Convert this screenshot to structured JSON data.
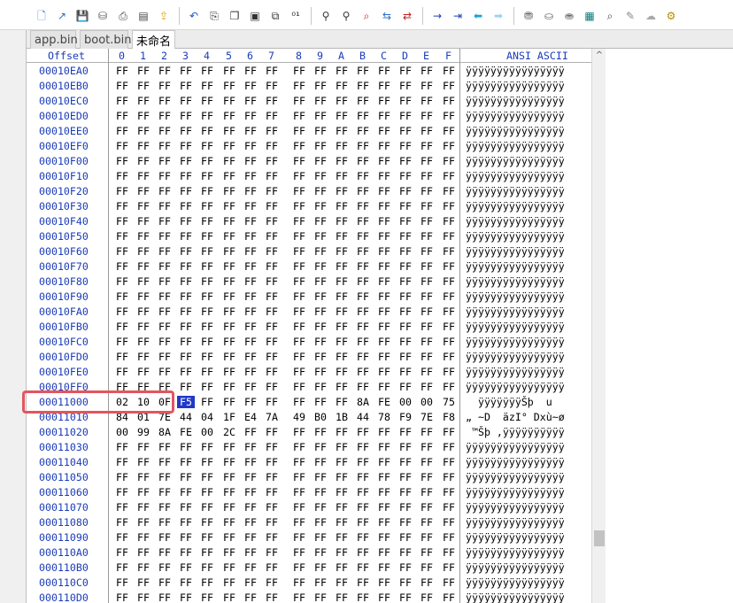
{
  "toolbar": {
    "buttons": [
      {
        "name": "new-file-icon",
        "glyph": "🗋",
        "color": "#3a6fd0"
      },
      {
        "name": "open-file-icon",
        "glyph": "↗",
        "color": "#2a70d0"
      },
      {
        "name": "save-icon",
        "glyph": "💾",
        "color": "#333"
      },
      {
        "name": "save-all-icon",
        "glyph": "⛁",
        "color": "#555"
      },
      {
        "name": "print-icon",
        "glyph": "⎙",
        "color": "#444"
      },
      {
        "name": "properties-icon",
        "glyph": "▤",
        "color": "#444"
      },
      {
        "name": "export-icon",
        "glyph": "⇪",
        "color": "#e0a000"
      },
      {
        "sep": true
      },
      {
        "name": "undo-icon",
        "glyph": "↶",
        "color": "#1a56c8"
      },
      {
        "name": "copy-icon",
        "glyph": "⎘",
        "color": "#333"
      },
      {
        "name": "copy-block-icon",
        "glyph": "❐",
        "color": "#333"
      },
      {
        "name": "paste-icon",
        "glyph": "▣",
        "color": "#333"
      },
      {
        "name": "paste-write-icon",
        "glyph": "⧉",
        "color": "#333"
      },
      {
        "name": "binary-icon",
        "glyph": "⁰¹",
        "color": "#333"
      },
      {
        "sep": true
      },
      {
        "name": "find-icon",
        "glyph": "⚲",
        "color": "#333"
      },
      {
        "name": "find-next-icon",
        "glyph": "⚲",
        "color": "#333"
      },
      {
        "name": "find-hex-icon",
        "glyph": "⌕",
        "color": "#c02020"
      },
      {
        "name": "replace-icon",
        "glyph": "⇆",
        "color": "#2a70d0"
      },
      {
        "name": "replace-hex-icon",
        "glyph": "⇄",
        "color": "#c02020"
      },
      {
        "sep": true
      },
      {
        "name": "goto-offset-icon",
        "glyph": "→",
        "color": "#1a3bb8"
      },
      {
        "name": "goto-sector-icon",
        "glyph": "⇥",
        "color": "#1a3bb8"
      },
      {
        "name": "back-icon",
        "glyph": "⬅",
        "color": "#1aa0d8"
      },
      {
        "name": "forward-icon",
        "glyph": "➡",
        "color": "#9ed2ec"
      },
      {
        "sep": true
      },
      {
        "name": "disk-icon",
        "glyph": "⛃",
        "color": "#666"
      },
      {
        "name": "disk-open-icon",
        "glyph": "⛀",
        "color": "#666"
      },
      {
        "name": "ram-icon",
        "glyph": "⛂",
        "color": "#666"
      },
      {
        "name": "calculator-icon",
        "glyph": "▦",
        "color": "#0a7a7a"
      },
      {
        "name": "zoom-icon",
        "glyph": "⌕",
        "color": "#444"
      },
      {
        "name": "tools-icon",
        "glyph": "✎",
        "color": "#888"
      },
      {
        "name": "cloud-icon",
        "glyph": "☁",
        "color": "#aaa"
      },
      {
        "name": "settings-icon",
        "glyph": "⚙",
        "color": "#b09000"
      }
    ]
  },
  "tabs": [
    {
      "label": "app.bin",
      "active": false
    },
    {
      "label": "boot.bin",
      "active": false
    },
    {
      "label": "未命名",
      "active": true
    }
  ],
  "hex": {
    "header": {
      "offset_label": "Offset",
      "columns": [
        "0",
        "1",
        "2",
        "3",
        "4",
        "5",
        "6",
        "7",
        "8",
        "9",
        "A",
        "B",
        "C",
        "D",
        "E",
        "F"
      ],
      "ascii_label": "ANSI ASCII"
    },
    "rows": [
      {
        "offset": "00010EA0",
        "bytes": [
          "FF",
          "FF",
          "FF",
          "FF",
          "FF",
          "FF",
          "FF",
          "FF",
          "FF",
          "FF",
          "FF",
          "FF",
          "FF",
          "FF",
          "FF",
          "FF"
        ],
        "ascii": "ÿÿÿÿÿÿÿÿÿÿÿÿÿÿÿÿ"
      },
      {
        "offset": "00010EB0",
        "bytes": [
          "FF",
          "FF",
          "FF",
          "FF",
          "FF",
          "FF",
          "FF",
          "FF",
          "FF",
          "FF",
          "FF",
          "FF",
          "FF",
          "FF",
          "FF",
          "FF"
        ],
        "ascii": "ÿÿÿÿÿÿÿÿÿÿÿÿÿÿÿÿ"
      },
      {
        "offset": "00010EC0",
        "bytes": [
          "FF",
          "FF",
          "FF",
          "FF",
          "FF",
          "FF",
          "FF",
          "FF",
          "FF",
          "FF",
          "FF",
          "FF",
          "FF",
          "FF",
          "FF",
          "FF"
        ],
        "ascii": "ÿÿÿÿÿÿÿÿÿÿÿÿÿÿÿÿ"
      },
      {
        "offset": "00010ED0",
        "bytes": [
          "FF",
          "FF",
          "FF",
          "FF",
          "FF",
          "FF",
          "FF",
          "FF",
          "FF",
          "FF",
          "FF",
          "FF",
          "FF",
          "FF",
          "FF",
          "FF"
        ],
        "ascii": "ÿÿÿÿÿÿÿÿÿÿÿÿÿÿÿÿ"
      },
      {
        "offset": "00010EE0",
        "bytes": [
          "FF",
          "FF",
          "FF",
          "FF",
          "FF",
          "FF",
          "FF",
          "FF",
          "FF",
          "FF",
          "FF",
          "FF",
          "FF",
          "FF",
          "FF",
          "FF"
        ],
        "ascii": "ÿÿÿÿÿÿÿÿÿÿÿÿÿÿÿÿ"
      },
      {
        "offset": "00010EF0",
        "bytes": [
          "FF",
          "FF",
          "FF",
          "FF",
          "FF",
          "FF",
          "FF",
          "FF",
          "FF",
          "FF",
          "FF",
          "FF",
          "FF",
          "FF",
          "FF",
          "FF"
        ],
        "ascii": "ÿÿÿÿÿÿÿÿÿÿÿÿÿÿÿÿ"
      },
      {
        "offset": "00010F00",
        "bytes": [
          "FF",
          "FF",
          "FF",
          "FF",
          "FF",
          "FF",
          "FF",
          "FF",
          "FF",
          "FF",
          "FF",
          "FF",
          "FF",
          "FF",
          "FF",
          "FF"
        ],
        "ascii": "ÿÿÿÿÿÿÿÿÿÿÿÿÿÿÿÿ"
      },
      {
        "offset": "00010F10",
        "bytes": [
          "FF",
          "FF",
          "FF",
          "FF",
          "FF",
          "FF",
          "FF",
          "FF",
          "FF",
          "FF",
          "FF",
          "FF",
          "FF",
          "FF",
          "FF",
          "FF"
        ],
        "ascii": "ÿÿÿÿÿÿÿÿÿÿÿÿÿÿÿÿ"
      },
      {
        "offset": "00010F20",
        "bytes": [
          "FF",
          "FF",
          "FF",
          "FF",
          "FF",
          "FF",
          "FF",
          "FF",
          "FF",
          "FF",
          "FF",
          "FF",
          "FF",
          "FF",
          "FF",
          "FF"
        ],
        "ascii": "ÿÿÿÿÿÿÿÿÿÿÿÿÿÿÿÿ"
      },
      {
        "offset": "00010F30",
        "bytes": [
          "FF",
          "FF",
          "FF",
          "FF",
          "FF",
          "FF",
          "FF",
          "FF",
          "FF",
          "FF",
          "FF",
          "FF",
          "FF",
          "FF",
          "FF",
          "FF"
        ],
        "ascii": "ÿÿÿÿÿÿÿÿÿÿÿÿÿÿÿÿ"
      },
      {
        "offset": "00010F40",
        "bytes": [
          "FF",
          "FF",
          "FF",
          "FF",
          "FF",
          "FF",
          "FF",
          "FF",
          "FF",
          "FF",
          "FF",
          "FF",
          "FF",
          "FF",
          "FF",
          "FF"
        ],
        "ascii": "ÿÿÿÿÿÿÿÿÿÿÿÿÿÿÿÿ"
      },
      {
        "offset": "00010F50",
        "bytes": [
          "FF",
          "FF",
          "FF",
          "FF",
          "FF",
          "FF",
          "FF",
          "FF",
          "FF",
          "FF",
          "FF",
          "FF",
          "FF",
          "FF",
          "FF",
          "FF"
        ],
        "ascii": "ÿÿÿÿÿÿÿÿÿÿÿÿÿÿÿÿ"
      },
      {
        "offset": "00010F60",
        "bytes": [
          "FF",
          "FF",
          "FF",
          "FF",
          "FF",
          "FF",
          "FF",
          "FF",
          "FF",
          "FF",
          "FF",
          "FF",
          "FF",
          "FF",
          "FF",
          "FF"
        ],
        "ascii": "ÿÿÿÿÿÿÿÿÿÿÿÿÿÿÿÿ"
      },
      {
        "offset": "00010F70",
        "bytes": [
          "FF",
          "FF",
          "FF",
          "FF",
          "FF",
          "FF",
          "FF",
          "FF",
          "FF",
          "FF",
          "FF",
          "FF",
          "FF",
          "FF",
          "FF",
          "FF"
        ],
        "ascii": "ÿÿÿÿÿÿÿÿÿÿÿÿÿÿÿÿ"
      },
      {
        "offset": "00010F80",
        "bytes": [
          "FF",
          "FF",
          "FF",
          "FF",
          "FF",
          "FF",
          "FF",
          "FF",
          "FF",
          "FF",
          "FF",
          "FF",
          "FF",
          "FF",
          "FF",
          "FF"
        ],
        "ascii": "ÿÿÿÿÿÿÿÿÿÿÿÿÿÿÿÿ"
      },
      {
        "offset": "00010F90",
        "bytes": [
          "FF",
          "FF",
          "FF",
          "FF",
          "FF",
          "FF",
          "FF",
          "FF",
          "FF",
          "FF",
          "FF",
          "FF",
          "FF",
          "FF",
          "FF",
          "FF"
        ],
        "ascii": "ÿÿÿÿÿÿÿÿÿÿÿÿÿÿÿÿ"
      },
      {
        "offset": "00010FA0",
        "bytes": [
          "FF",
          "FF",
          "FF",
          "FF",
          "FF",
          "FF",
          "FF",
          "FF",
          "FF",
          "FF",
          "FF",
          "FF",
          "FF",
          "FF",
          "FF",
          "FF"
        ],
        "ascii": "ÿÿÿÿÿÿÿÿÿÿÿÿÿÿÿÿ"
      },
      {
        "offset": "00010FB0",
        "bytes": [
          "FF",
          "FF",
          "FF",
          "FF",
          "FF",
          "FF",
          "FF",
          "FF",
          "FF",
          "FF",
          "FF",
          "FF",
          "FF",
          "FF",
          "FF",
          "FF"
        ],
        "ascii": "ÿÿÿÿÿÿÿÿÿÿÿÿÿÿÿÿ"
      },
      {
        "offset": "00010FC0",
        "bytes": [
          "FF",
          "FF",
          "FF",
          "FF",
          "FF",
          "FF",
          "FF",
          "FF",
          "FF",
          "FF",
          "FF",
          "FF",
          "FF",
          "FF",
          "FF",
          "FF"
        ],
        "ascii": "ÿÿÿÿÿÿÿÿÿÿÿÿÿÿÿÿ"
      },
      {
        "offset": "00010FD0",
        "bytes": [
          "FF",
          "FF",
          "FF",
          "FF",
          "FF",
          "FF",
          "FF",
          "FF",
          "FF",
          "FF",
          "FF",
          "FF",
          "FF",
          "FF",
          "FF",
          "FF"
        ],
        "ascii": "ÿÿÿÿÿÿÿÿÿÿÿÿÿÿÿÿ"
      },
      {
        "offset": "00010FE0",
        "bytes": [
          "FF",
          "FF",
          "FF",
          "FF",
          "FF",
          "FF",
          "FF",
          "FF",
          "FF",
          "FF",
          "FF",
          "FF",
          "FF",
          "FF",
          "FF",
          "FF"
        ],
        "ascii": "ÿÿÿÿÿÿÿÿÿÿÿÿÿÿÿÿ"
      },
      {
        "offset": "00010FF0",
        "bytes": [
          "FF",
          "FF",
          "FF",
          "FF",
          "FF",
          "FF",
          "FF",
          "FF",
          "FF",
          "FF",
          "FF",
          "FF",
          "FF",
          "FF",
          "FF",
          "FF"
        ],
        "ascii": "ÿÿÿÿÿÿÿÿÿÿÿÿÿÿÿÿ"
      },
      {
        "offset": "00011000",
        "bytes": [
          "02",
          "10",
          "0F",
          "F5",
          "FF",
          "FF",
          "FF",
          "FF",
          "FF",
          "FF",
          "FF",
          "8A",
          "FE",
          "00",
          "00",
          "75"
        ],
        "ascii": "  ÿÿÿÿÿÿÿŠþ  u",
        "highlight_byte": 3
      },
      {
        "offset": "00011010",
        "bytes": [
          "84",
          "01",
          "7E",
          "44",
          "04",
          "1F",
          "E4",
          "7A",
          "49",
          "B0",
          "1B",
          "44",
          "78",
          "F9",
          "7E",
          "F8"
        ],
        "ascii": "„ ~D  äzI° Dxù~ø"
      },
      {
        "offset": "00011020",
        "bytes": [
          "00",
          "99",
          "8A",
          "FE",
          "00",
          "2C",
          "FF",
          "FF",
          "FF",
          "FF",
          "FF",
          "FF",
          "FF",
          "FF",
          "FF",
          "FF"
        ],
        "ascii": " ™Šþ ,ÿÿÿÿÿÿÿÿÿÿ"
      },
      {
        "offset": "00011030",
        "bytes": [
          "FF",
          "FF",
          "FF",
          "FF",
          "FF",
          "FF",
          "FF",
          "FF",
          "FF",
          "FF",
          "FF",
          "FF",
          "FF",
          "FF",
          "FF",
          "FF"
        ],
        "ascii": "ÿÿÿÿÿÿÿÿÿÿÿÿÿÿÿÿ"
      },
      {
        "offset": "00011040",
        "bytes": [
          "FF",
          "FF",
          "FF",
          "FF",
          "FF",
          "FF",
          "FF",
          "FF",
          "FF",
          "FF",
          "FF",
          "FF",
          "FF",
          "FF",
          "FF",
          "FF"
        ],
        "ascii": "ÿÿÿÿÿÿÿÿÿÿÿÿÿÿÿÿ"
      },
      {
        "offset": "00011050",
        "bytes": [
          "FF",
          "FF",
          "FF",
          "FF",
          "FF",
          "FF",
          "FF",
          "FF",
          "FF",
          "FF",
          "FF",
          "FF",
          "FF",
          "FF",
          "FF",
          "FF"
        ],
        "ascii": "ÿÿÿÿÿÿÿÿÿÿÿÿÿÿÿÿ"
      },
      {
        "offset": "00011060",
        "bytes": [
          "FF",
          "FF",
          "FF",
          "FF",
          "FF",
          "FF",
          "FF",
          "FF",
          "FF",
          "FF",
          "FF",
          "FF",
          "FF",
          "FF",
          "FF",
          "FF"
        ],
        "ascii": "ÿÿÿÿÿÿÿÿÿÿÿÿÿÿÿÿ"
      },
      {
        "offset": "00011070",
        "bytes": [
          "FF",
          "FF",
          "FF",
          "FF",
          "FF",
          "FF",
          "FF",
          "FF",
          "FF",
          "FF",
          "FF",
          "FF",
          "FF",
          "FF",
          "FF",
          "FF"
        ],
        "ascii": "ÿÿÿÿÿÿÿÿÿÿÿÿÿÿÿÿ"
      },
      {
        "offset": "00011080",
        "bytes": [
          "FF",
          "FF",
          "FF",
          "FF",
          "FF",
          "FF",
          "FF",
          "FF",
          "FF",
          "FF",
          "FF",
          "FF",
          "FF",
          "FF",
          "FF",
          "FF"
        ],
        "ascii": "ÿÿÿÿÿÿÿÿÿÿÿÿÿÿÿÿ"
      },
      {
        "offset": "00011090",
        "bytes": [
          "FF",
          "FF",
          "FF",
          "FF",
          "FF",
          "FF",
          "FF",
          "FF",
          "FF",
          "FF",
          "FF",
          "FF",
          "FF",
          "FF",
          "FF",
          "FF"
        ],
        "ascii": "ÿÿÿÿÿÿÿÿÿÿÿÿÿÿÿÿ"
      },
      {
        "offset": "000110A0",
        "bytes": [
          "FF",
          "FF",
          "FF",
          "FF",
          "FF",
          "FF",
          "FF",
          "FF",
          "FF",
          "FF",
          "FF",
          "FF",
          "FF",
          "FF",
          "FF",
          "FF"
        ],
        "ascii": "ÿÿÿÿÿÿÿÿÿÿÿÿÿÿÿÿ"
      },
      {
        "offset": "000110B0",
        "bytes": [
          "FF",
          "FF",
          "FF",
          "FF",
          "FF",
          "FF",
          "FF",
          "FF",
          "FF",
          "FF",
          "FF",
          "FF",
          "FF",
          "FF",
          "FF",
          "FF"
        ],
        "ascii": "ÿÿÿÿÿÿÿÿÿÿÿÿÿÿÿÿ"
      },
      {
        "offset": "000110C0",
        "bytes": [
          "FF",
          "FF",
          "FF",
          "FF",
          "FF",
          "FF",
          "FF",
          "FF",
          "FF",
          "FF",
          "FF",
          "FF",
          "FF",
          "FF",
          "FF",
          "FF"
        ],
        "ascii": "ÿÿÿÿÿÿÿÿÿÿÿÿÿÿÿÿ"
      },
      {
        "offset": "000110D0",
        "bytes": [
          "FF",
          "FF",
          "FF",
          "FF",
          "FF",
          "FF",
          "FF",
          "FF",
          "FF",
          "FF",
          "FF",
          "FF",
          "FF",
          "FF",
          "FF",
          "FF"
        ],
        "ascii": "ÿÿÿÿÿÿÿÿÿÿÿÿÿÿÿÿ"
      }
    ]
  },
  "colors": {
    "offset_text": "#1a3bb8",
    "selection": "#2039c8",
    "annotation_box": "#e35560"
  }
}
